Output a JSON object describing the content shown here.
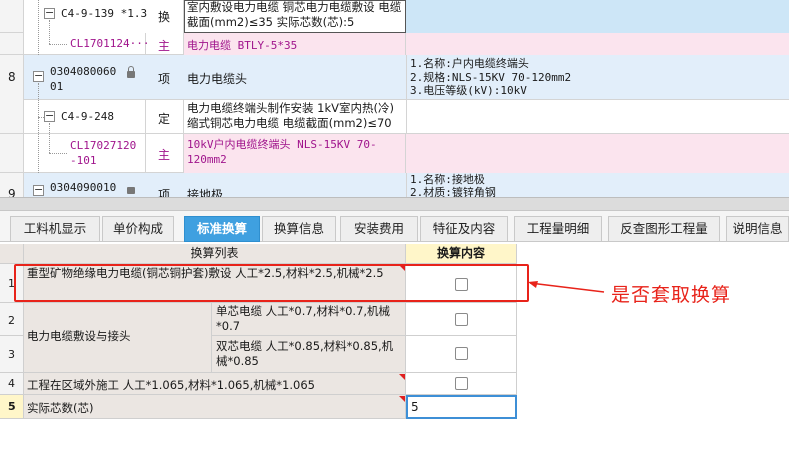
{
  "top_grid": {
    "rows": [
      {
        "num": "",
        "code": "C4-9-139 *1.3",
        "type": "换",
        "name": "室内敷设电力电缆 铜芯电力电缆敷设 电缆截面(mm2)≤35  实际芯数(芯):5",
        "feature": ""
      },
      {
        "num": "",
        "code": "CL1701124···",
        "type": "主",
        "name": "电力电缆 BTLY-5*35",
        "feature": ""
      },
      {
        "num": "8",
        "code": "030408006001",
        "type": "项",
        "name": "电力电缆头",
        "feature_lines": [
          "1.名称:户内电缆终端头",
          "2.规格:NLS-15KV 70-120mm2",
          "3.电压等级(kV):10kV"
        ]
      },
      {
        "num": "",
        "code": "C4-9-248",
        "type": "定",
        "name": "电力电缆终端头制作安装 1kV室内热(冷)缩式铜芯电力电缆 电缆截面(mm2)≤70",
        "feature": ""
      },
      {
        "num": "",
        "code": "CL17027120-101",
        "type": "主",
        "name": "10kV户内电缆终端头 NLS-15KV 70-120mm2",
        "feature": ""
      },
      {
        "num": "9",
        "code": "030409001001",
        "type": "项",
        "name": "接地极",
        "feature_lines": [
          "1.名称:接地极",
          "2.材质:镀锌角钢"
        ]
      }
    ]
  },
  "tabs": [
    "工料机显示",
    "单价构成",
    "标准换算",
    "换算信息",
    "安装费用",
    "特征及内容",
    "工程量明细",
    "反查图形工程量",
    "说明信息"
  ],
  "active_tab": "标准换算",
  "conversion_table": {
    "header_list": "换算列表",
    "header_content": "换算内容",
    "rows": [
      {
        "num": "1",
        "text": "重型矿物绝缘电力电缆(铜芯铜护套)敷设 人工*2.5,材料*2.5,机械*2.5",
        "checked": false
      },
      {
        "num": "2",
        "group": "电力电缆敷设与接头",
        "text": "单芯电缆 人工*0.7,材料*0.7,机械*0.7",
        "checked": false
      },
      {
        "num": "3",
        "text": "双芯电缆 人工*0.85,材料*0.85,机械*0.85",
        "checked": false
      },
      {
        "num": "4",
        "text": "工程在区域外施工 人工*1.065,材料*1.065,机械*1.065",
        "checked": false
      },
      {
        "num": "5",
        "text": "实际芯数(芯)",
        "value": "5"
      }
    ]
  },
  "annotation": {
    "label": "是否套取换算",
    "color": "#e8231a"
  }
}
